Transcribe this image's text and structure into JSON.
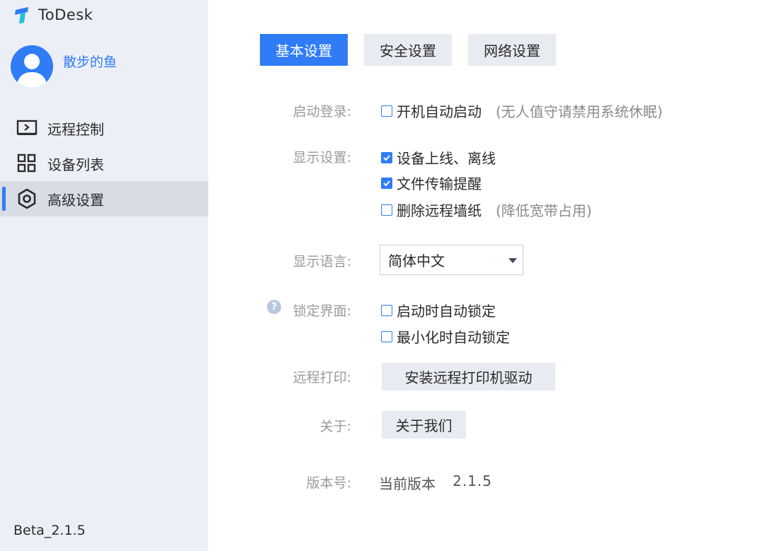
{
  "app": {
    "name": "ToDesk",
    "brand_color": "#2f7cf6"
  },
  "user": {
    "name": "散步的鱼"
  },
  "sidebar": {
    "items": [
      {
        "label": "远程控制",
        "icon": "monitor-icon",
        "active": false
      },
      {
        "label": "设备列表",
        "icon": "grid-icon",
        "active": false
      },
      {
        "label": "高级设置",
        "icon": "gear-icon",
        "active": true
      }
    ],
    "version": "Beta_2.1.5"
  },
  "tabs": [
    {
      "label": "基本设置",
      "active": true
    },
    {
      "label": "安全设置",
      "active": false
    },
    {
      "label": "网络设置",
      "active": false
    }
  ],
  "settings": {
    "startup": {
      "label": "启动登录:",
      "auto_start": {
        "label": "开机自动启动",
        "checked": false,
        "hint": "(无人值守请禁用系统休眠)"
      }
    },
    "display": {
      "label": "显示设置:",
      "options": [
        {
          "label": "设备上线、离线",
          "checked": true,
          "hint": ""
        },
        {
          "label": "文件传输提醒",
          "checked": true,
          "hint": ""
        },
        {
          "label": "删除远程墙纸",
          "checked": false,
          "hint": "(降低宽带占用)"
        }
      ]
    },
    "language": {
      "label": "显示语言:",
      "value": "简体中文"
    },
    "lock": {
      "label": "锁定界面:",
      "help_icon": "question-icon",
      "options": [
        {
          "label": "启动时自动锁定",
          "checked": false
        },
        {
          "label": "最小化时自动锁定",
          "checked": false
        }
      ]
    },
    "print": {
      "label": "远程打印:",
      "button": "安装远程打印机驱动"
    },
    "about": {
      "label": "关于:",
      "button": "关于我们"
    },
    "version": {
      "label": "版本号:",
      "text": "当前版本",
      "value": "2.1.5"
    }
  }
}
